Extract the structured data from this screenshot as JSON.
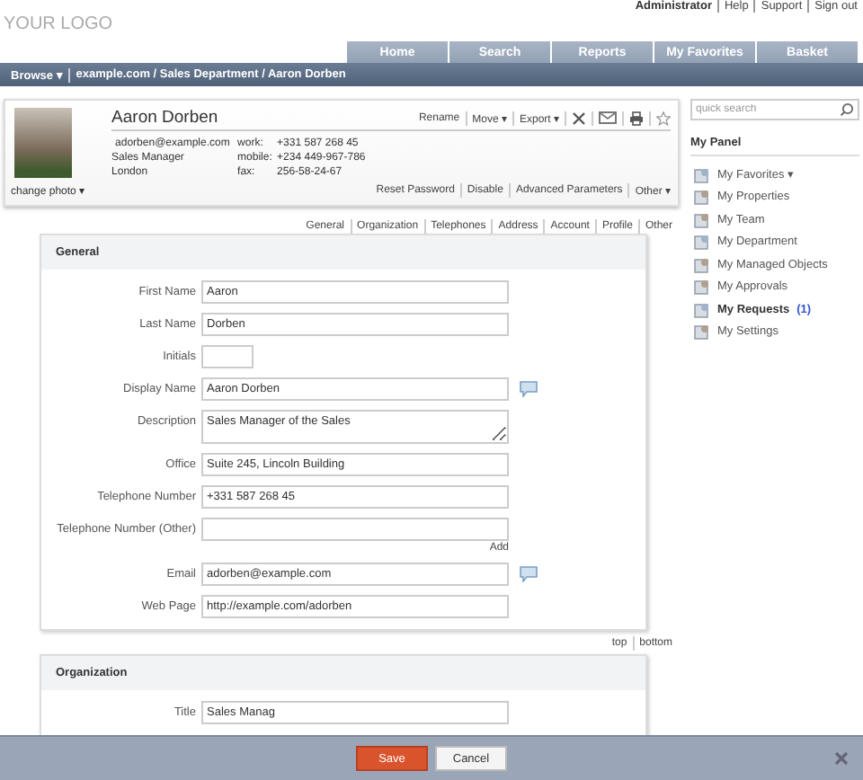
{
  "header": {
    "logo": "YOUR LOGO",
    "user_links": [
      "Administrator",
      "Help",
      "Support",
      "Sign out"
    ]
  },
  "nav_tabs": [
    "Home",
    "Search",
    "Reports",
    "My Favorites",
    "Basket"
  ],
  "breadcrumb": {
    "browse": "Browse ▾",
    "path": "example.com / Sales Department / Aaron Dorben"
  },
  "profile": {
    "name": "Aaron Dorben",
    "change_photo": "change photo ▾",
    "details": [
      "adorben@example.com",
      "Sales Manager",
      "London"
    ],
    "phones": [
      {
        "label": "work:",
        "value": "+331 587 268 45"
      },
      {
        "label": "mobile:",
        "value": "+234 449-967-786"
      },
      {
        "label": "fax:",
        "value": "256-58-24-67"
      }
    ],
    "toolbar": [
      {
        "label": "Rename",
        "kind": "text"
      },
      {
        "label": "Move ▾",
        "kind": "text"
      },
      {
        "label": "Export ▾",
        "kind": "text"
      },
      {
        "kind": "delete"
      },
      {
        "kind": "mail"
      },
      {
        "kind": "print"
      },
      {
        "kind": "star"
      }
    ],
    "actions": [
      "Reset Password",
      "Disable",
      "Advanced Parameters",
      "Other ▾"
    ]
  },
  "section_links": [
    "General",
    "Organization",
    "Telephones",
    "Address",
    "Account",
    "Profile",
    "Other"
  ],
  "general": {
    "title": "General",
    "fields": [
      {
        "label": "First Name",
        "value": "Aaron",
        "kind": "text",
        "note": false
      },
      {
        "label": "Last Name",
        "value": "Dorben",
        "kind": "text",
        "note": false
      },
      {
        "label": "Initials",
        "kind": "short",
        "note": false
      },
      {
        "label": "Display Name",
        "value": "Aaron Dorben",
        "kind": "text",
        "note": true
      },
      {
        "label": "Description",
        "value": "Sales Manager of the Sales",
        "kind": "textarea",
        "note": false
      },
      {
        "label": "Office",
        "value": "Suite 245, Lincoln Building",
        "kind": "text",
        "note": false
      },
      {
        "label": "Telephone Number",
        "value": "+331 587 268 45",
        "kind": "text",
        "note": false
      },
      {
        "label": "Telephone Number (Other)",
        "kind": "text",
        "note": false,
        "action": "Add"
      },
      {
        "label": "Email",
        "value": "adorben@example.com",
        "kind": "text",
        "note": true
      },
      {
        "label": "Web Page",
        "value": "http://example.com/adorben",
        "kind": "text",
        "note": false
      }
    ]
  },
  "jump_links": [
    "top",
    "bottom"
  ],
  "organization": {
    "title": "Organization",
    "fields": [
      {
        "label": "Title",
        "value": "Sales Manag",
        "kind": "text",
        "note": false
      }
    ]
  },
  "sidebar": {
    "search": {
      "placeholder": "quick search"
    },
    "title": "My Panel",
    "items": [
      {
        "label": "My Favorites ▾",
        "unread": false
      },
      {
        "label": "My Properties",
        "unread": false
      },
      {
        "label": "My Team",
        "unread": false
      },
      {
        "label": "My Department",
        "unread": false
      },
      {
        "label": "My Managed Objects",
        "unread": false
      },
      {
        "label": "My Approvals",
        "unread": false
      },
      {
        "label": "My Requests",
        "count": "(1)",
        "unread": true
      },
      {
        "label": "My Settings",
        "unread": false
      }
    ]
  },
  "footer_buttons": [
    {
      "label": "Save",
      "kind": "primary"
    },
    {
      "label": "Cancel",
      "kind": "secondary"
    }
  ]
}
